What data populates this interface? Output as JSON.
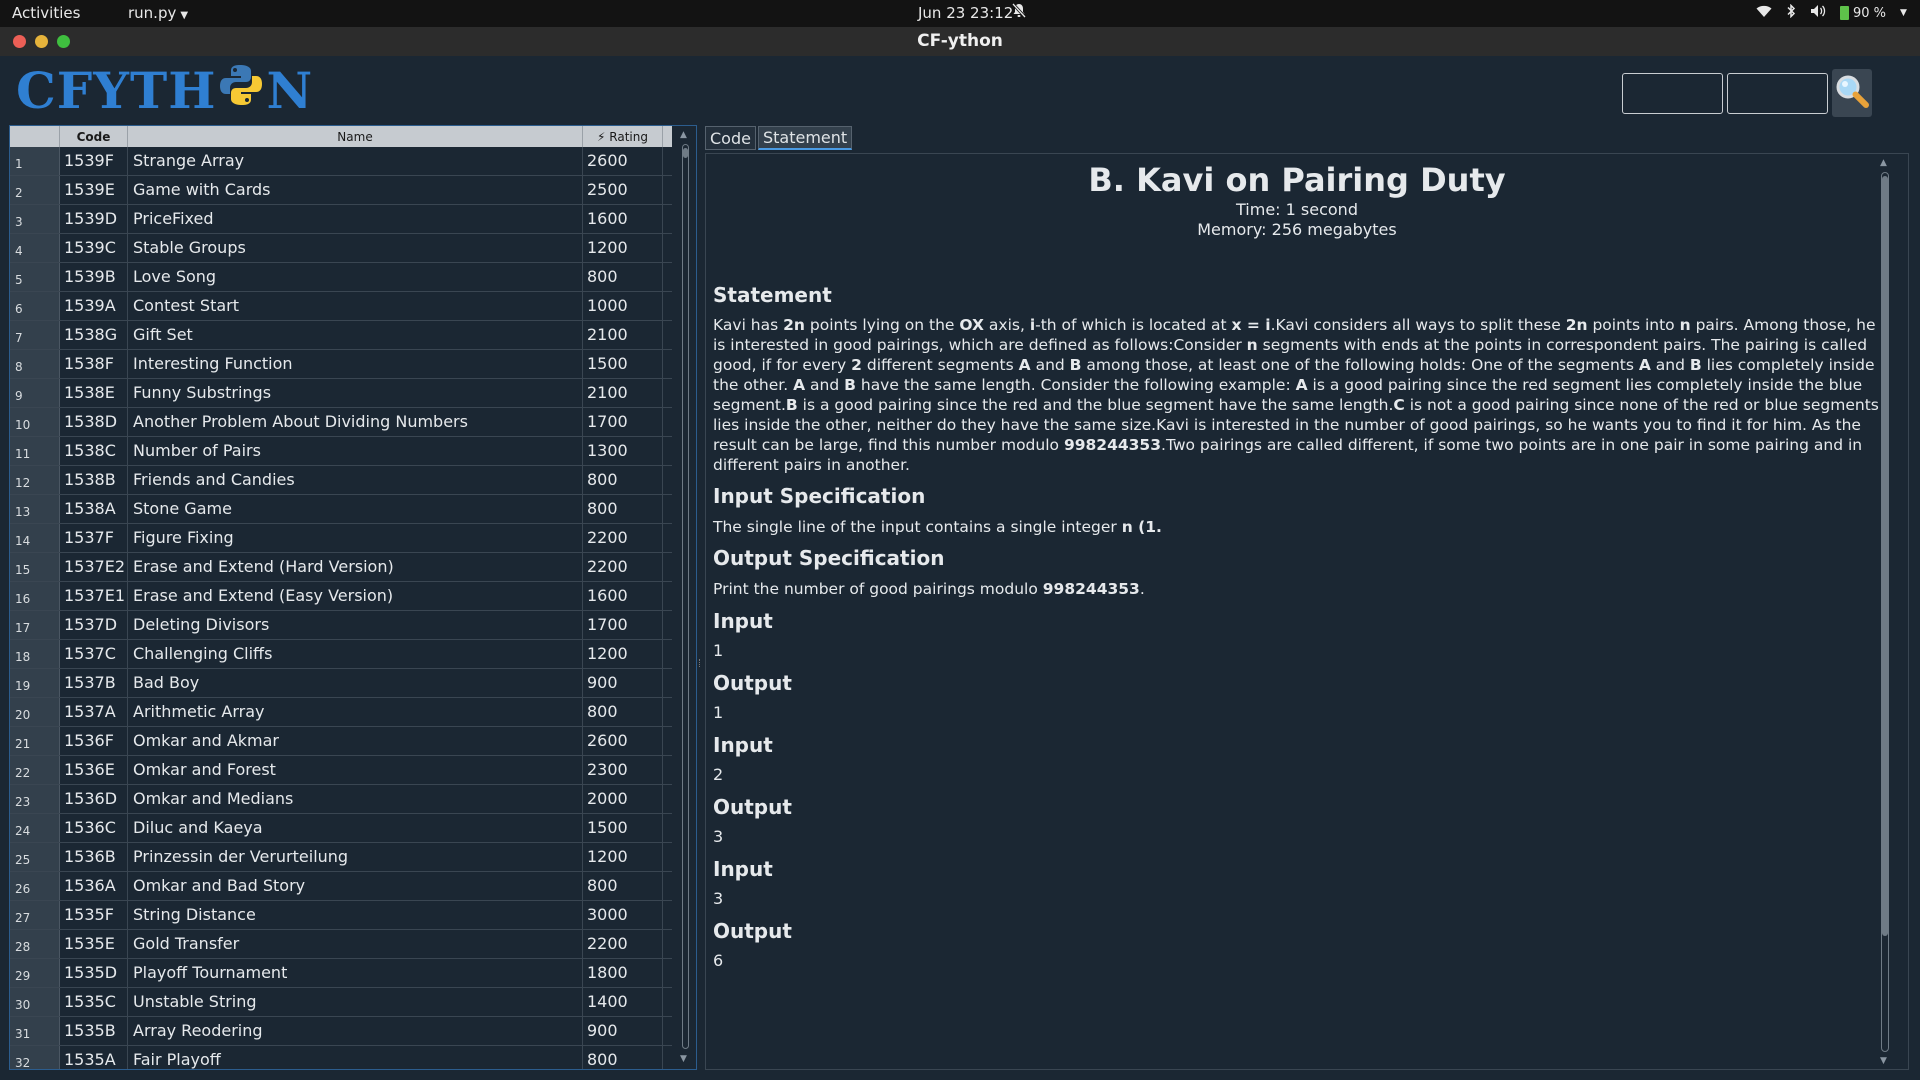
{
  "topbar": {
    "activities": "Activities",
    "app_menu": "run.py",
    "clock": "Jun 23  23:12",
    "battery": "90 %"
  },
  "window": {
    "title": "CF-ython"
  },
  "logo": {
    "left": "CFYTH",
    "right": "N"
  },
  "search": {
    "contest_value": "",
    "problem_value": ""
  },
  "table": {
    "headers": {
      "code": "Code",
      "name": "Name",
      "rating": "⚡ Rating"
    },
    "rows": [
      {
        "idx": "1",
        "code": "1539F",
        "name": "Strange Array",
        "rating": "2600"
      },
      {
        "idx": "2",
        "code": "1539E",
        "name": "Game with Cards",
        "rating": "2500"
      },
      {
        "idx": "3",
        "code": "1539D",
        "name": "PriceFixed",
        "rating": "1600"
      },
      {
        "idx": "4",
        "code": "1539C",
        "name": "Stable Groups",
        "rating": "1200"
      },
      {
        "idx": "5",
        "code": "1539B",
        "name": "Love Song",
        "rating": "800"
      },
      {
        "idx": "6",
        "code": "1539A",
        "name": "Contest Start",
        "rating": "1000"
      },
      {
        "idx": "7",
        "code": "1538G",
        "name": "Gift Set",
        "rating": "2100"
      },
      {
        "idx": "8",
        "code": "1538F",
        "name": "Interesting Function",
        "rating": "1500"
      },
      {
        "idx": "9",
        "code": "1538E",
        "name": "Funny Substrings",
        "rating": "2100"
      },
      {
        "idx": "10",
        "code": "1538D",
        "name": "Another Problem About Dividing Numbers",
        "rating": "1700"
      },
      {
        "idx": "11",
        "code": "1538C",
        "name": "Number of Pairs",
        "rating": "1300"
      },
      {
        "idx": "12",
        "code": "1538B",
        "name": "Friends and Candies",
        "rating": "800"
      },
      {
        "idx": "13",
        "code": "1538A",
        "name": "Stone Game",
        "rating": "800"
      },
      {
        "idx": "14",
        "code": "1537F",
        "name": "Figure Fixing",
        "rating": "2200"
      },
      {
        "idx": "15",
        "code": "1537E2",
        "name": "Erase and Extend (Hard Version)",
        "rating": "2200"
      },
      {
        "idx": "16",
        "code": "1537E1",
        "name": "Erase and Extend (Easy Version)",
        "rating": "1600"
      },
      {
        "idx": "17",
        "code": "1537D",
        "name": "Deleting Divisors",
        "rating": "1700"
      },
      {
        "idx": "18",
        "code": "1537C",
        "name": "Challenging Cliffs",
        "rating": "1200"
      },
      {
        "idx": "19",
        "code": "1537B",
        "name": "Bad Boy",
        "rating": "900"
      },
      {
        "idx": "20",
        "code": "1537A",
        "name": "Arithmetic Array",
        "rating": "800"
      },
      {
        "idx": "21",
        "code": "1536F",
        "name": "Omkar and Akmar",
        "rating": "2600"
      },
      {
        "idx": "22",
        "code": "1536E",
        "name": "Omkar and Forest",
        "rating": "2300"
      },
      {
        "idx": "23",
        "code": "1536D",
        "name": "Omkar and Medians",
        "rating": "2000"
      },
      {
        "idx": "24",
        "code": "1536C",
        "name": "Diluc and Kaeya",
        "rating": "1500"
      },
      {
        "idx": "25",
        "code": "1536B",
        "name": "Prinzessin der Verurteilung",
        "rating": "1200"
      },
      {
        "idx": "26",
        "code": "1536A",
        "name": "Omkar and Bad Story",
        "rating": "800"
      },
      {
        "idx": "27",
        "code": "1535F",
        "name": "String Distance",
        "rating": "3000"
      },
      {
        "idx": "28",
        "code": "1535E",
        "name": "Gold Transfer",
        "rating": "2200"
      },
      {
        "idx": "29",
        "code": "1535D",
        "name": "Playoff Tournament",
        "rating": "1800"
      },
      {
        "idx": "30",
        "code": "1535C",
        "name": "Unstable String",
        "rating": "1400"
      },
      {
        "idx": "31",
        "code": "1535B",
        "name": "Array Reodering",
        "rating": "900"
      },
      {
        "idx": "32",
        "code": "1535A",
        "name": "Fair Playoff",
        "rating": "800"
      }
    ]
  },
  "tabs": [
    {
      "label": "Code",
      "active": false
    },
    {
      "label": "Statement",
      "active": true
    }
  ],
  "statement": {
    "title": "B. Kavi on Pairing Duty",
    "time": "Time: 1 second",
    "memory": "Memory: 256 megabytes",
    "statement_heading": "Statement",
    "statement_html": "Kavi has <b>2n</b> points lying on the <b>OX</b> axis, <b>i</b>-th of which is located at <b>x = i</b>.Kavi considers all ways to split these <b>2n</b> points into <b>n</b> pairs. Among those, he is interested in good pairings, which are defined as follows:Consider <b>n</b> segments with ends at the points in correspondent pairs. The pairing is called good, if for every <b>2</b> different segments <b>A</b> and <b>B</b> among those, at least one of the following holds: One of the segments <b>A</b> and <b>B</b> lies completely inside the other. <b>A</b> and <b>B</b> have the same length. Consider the following example: <b>A</b> is a good pairing since the red segment lies completely inside the blue segment.<b>B</b> is a good pairing since the red and the blue segment have the same length.<b>C</b> is not a good pairing since none of the red or blue segments lies inside the other, neither do they have the same size.Kavi is interested in the number of good pairings, so he wants you to find it for him. As the result can be large, find this number modulo <b>998244353</b>.Two pairings are called different, if some two points are in one pair in some pairing and in different pairs in another.",
    "input_heading": "Input Specification",
    "input_html": "The single line of the input contains a single integer <b>n (1.</b>",
    "output_heading": "Output Specification",
    "output_html": "Print the number of good pairings modulo <b>998244353</b>.",
    "samples": [
      {
        "input_label": "Input",
        "input": "1",
        "output_label": "Output",
        "output": "1"
      },
      {
        "input_label": "Input",
        "input": "2",
        "output_label": "Output",
        "output": "3"
      },
      {
        "input_label": "Input",
        "input": "3",
        "output_label": "Output",
        "output": "6"
      }
    ]
  },
  "colors": {
    "background": "#1b2733",
    "logo": "#2f7fd2",
    "python_blue": "#3b78b5",
    "python_yellow": "#f7c934",
    "tab_accent": "#4a9be4"
  },
  "icons": [
    "bell-off-icon",
    "wifi-icon",
    "bluetooth-icon",
    "volume-icon",
    "battery-icon",
    "python-logo-icon",
    "search-icon"
  ]
}
